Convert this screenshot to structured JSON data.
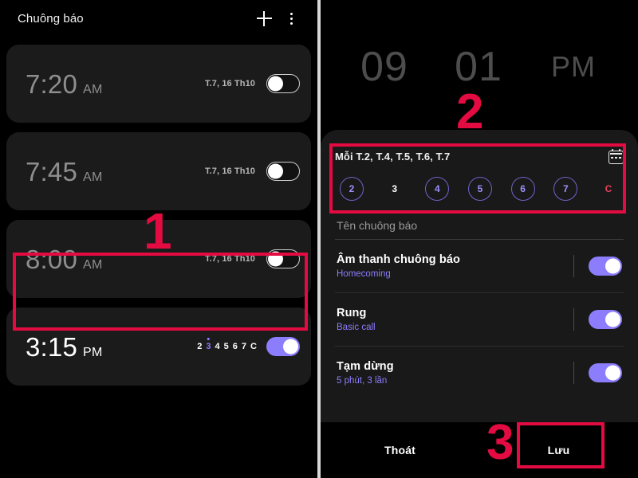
{
  "left_panel": {
    "appbar": {
      "title": "Chuông báo",
      "add_icon": "plus-icon",
      "more_icon": "overflow-menu-icon"
    },
    "alarms": [
      {
        "time": "7:20",
        "meridiem": "AM",
        "schedule": "T.7, 16 Th10",
        "enabled": false,
        "active": false
      },
      {
        "time": "7:45",
        "meridiem": "AM",
        "schedule": "T.7, 16 Th10",
        "enabled": false,
        "active": false
      },
      {
        "time": "8:00",
        "meridiem": "AM",
        "schedule": "T.7, 16 Th10",
        "enabled": false,
        "active": false
      },
      {
        "time": "3:15",
        "meridiem": "PM",
        "days": [
          "2",
          "3",
          "4",
          "5",
          "6",
          "7",
          "C"
        ],
        "days_on": [
          "3"
        ],
        "enabled": true,
        "active": true
      }
    ]
  },
  "right_panel": {
    "time_picker": {
      "hour": "09",
      "minute": "01",
      "meridiem": "PM"
    },
    "repeat": {
      "label": "Mỗi T.2, T.4, T.5, T.6, T.7",
      "calendar_icon": "calendar-icon",
      "days": [
        {
          "label": "2",
          "selected": true,
          "sunday": false
        },
        {
          "label": "3",
          "selected": false,
          "sunday": false
        },
        {
          "label": "4",
          "selected": true,
          "sunday": false
        },
        {
          "label": "5",
          "selected": true,
          "sunday": false
        },
        {
          "label": "6",
          "selected": true,
          "sunday": false
        },
        {
          "label": "7",
          "selected": true,
          "sunday": false
        },
        {
          "label": "C",
          "selected": false,
          "sunday": true
        }
      ]
    },
    "name_field": {
      "placeholder": "Tên chuông báo",
      "value": ""
    },
    "options": [
      {
        "title": "Âm thanh chuông báo",
        "subtitle": "Homecoming",
        "enabled": true
      },
      {
        "title": "Rung",
        "subtitle": "Basic call",
        "enabled": true
      },
      {
        "title": "Tạm dừng",
        "subtitle": "5 phút, 3 lần",
        "enabled": true
      }
    ],
    "bottom_bar": {
      "cancel_label": "Thoát",
      "save_label": "Lưu"
    }
  },
  "annotations": {
    "colors": {
      "marker": "#e30b41",
      "accent": "#8c7dfc",
      "sunday": "#e8415c"
    },
    "steps": [
      {
        "number": "1"
      },
      {
        "number": "2"
      },
      {
        "number": "3"
      }
    ]
  }
}
